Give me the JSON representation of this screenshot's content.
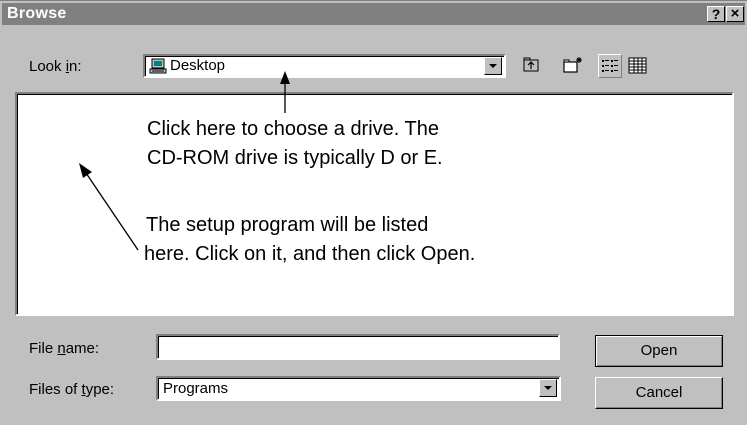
{
  "window": {
    "title": "Browse",
    "help_glyph": "?",
    "close_glyph": "×"
  },
  "lookin": {
    "label_pre": "Look ",
    "label_key": "i",
    "label_post": "n:",
    "value": "Desktop"
  },
  "toolbar": {
    "icons": [
      "up-folder-icon",
      "new-folder-icon",
      "list-view-icon",
      "details-view-icon"
    ]
  },
  "annotations": {
    "drive_line1": "Click here to choose a drive. The",
    "drive_line2": "CD-ROM drive is typically D or E.",
    "setup_line1": "The setup program will be listed",
    "setup_line2": "here. Click on it, and then click Open."
  },
  "filename": {
    "label_pre": "File ",
    "label_key": "n",
    "label_post": "ame:",
    "value": ""
  },
  "filetype": {
    "label_pre": "Files of ",
    "label_key": "t",
    "label_post": "ype:",
    "value": "Programs"
  },
  "buttons": {
    "open": "Open",
    "cancel": "Cancel"
  },
  "colors": {
    "face": "#c0c0c0",
    "titlebar_inactive": "#808080",
    "window": "#ffffff"
  }
}
